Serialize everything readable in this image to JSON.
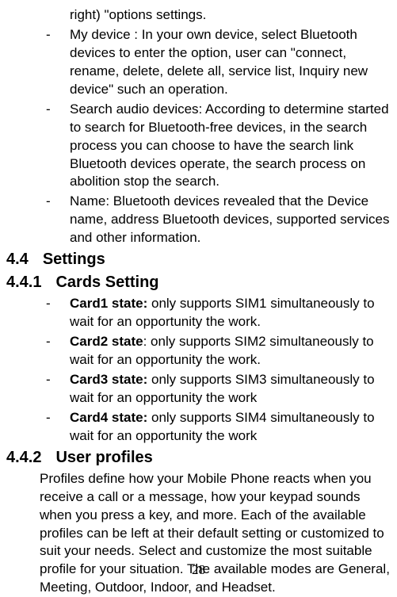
{
  "bullets": {
    "b0_cont": "right) \"options settings.",
    "b1": "My device :   In your own device, select Bluetooth devices to enter the option, user can \"connect, rename, delete, delete all, service list, Inquiry new device\" such an operation.",
    "b2": "Search audio devices: According to determine started to search for Bluetooth-free devices, in the search process you can choose to have the search link Bluetooth devices operate, the search process on abolition stop the search.",
    "b3": "Name: Bluetooth devices revealed that the Device name, address Bluetooth devices, supported services and other information."
  },
  "headings": {
    "h44_num": "4.4",
    "h44_text": "Settings",
    "h441_num": "4.4.1",
    "h441_text": "Cards Setting",
    "h442_num": "4.4.2",
    "h442_text": "User profiles"
  },
  "cards": {
    "c1_label": "Card1 state:",
    "c1_text": " only supports SIM1 simultaneously to wait for an opportunity the work.",
    "c2_label": "Card2 state",
    "c2_text": ": only supports SIM2 simultaneously to wait for an opportunity the work.",
    "c3_label": "Card3 state:",
    "c3_text": " only supports SIM3 simultaneously to wait for an opportunity the work",
    "c4_label": "Card4 state:",
    "c4_text": " only supports SIM4 simultaneously to wait for an opportunity the work"
  },
  "profiles_para": "Profiles define how your Mobile Phone reacts when you receive a call or a message, how your keypad sounds when you press a key, and more. Each of the available profiles can be left at their default setting or customized to suit your needs. Select and customize the most suitable profile for your situation. The available modes are General, Meeting, Outdoor, Indoor, and Headset.",
  "dash": "-",
  "page_number": "28"
}
